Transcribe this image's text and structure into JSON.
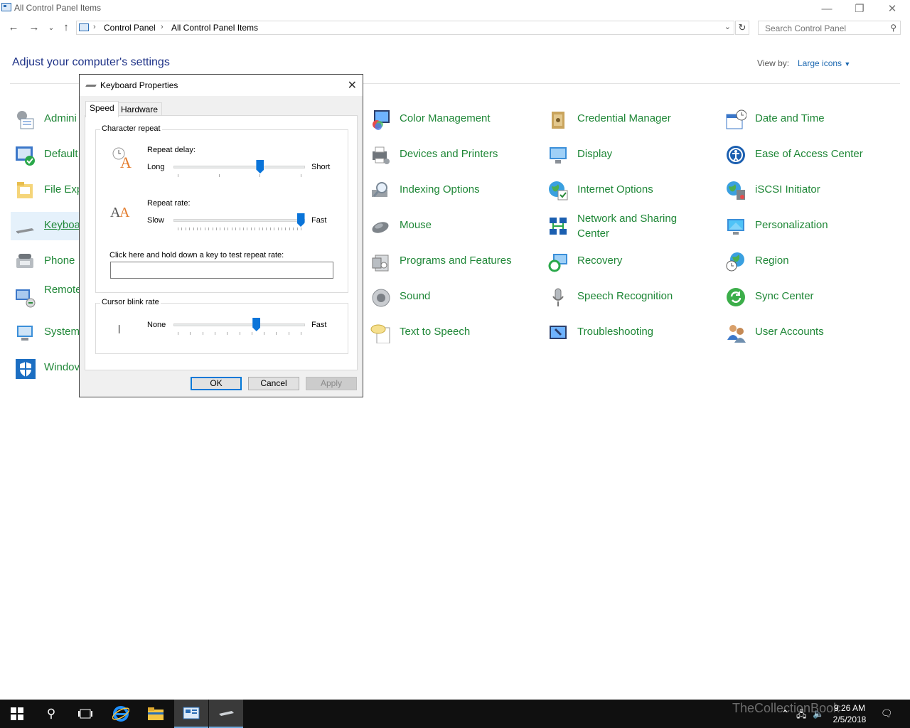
{
  "window": {
    "title": "All Control Panel Items",
    "controls": {
      "minimize": "—",
      "restore": "❐",
      "close": "✕"
    }
  },
  "address_bar": {
    "breadcrumbs": [
      "Control Panel",
      "All Control Panel Items"
    ],
    "search_placeholder": "Search Control Panel"
  },
  "header": {
    "title": "Adjust your computer's settings",
    "view_by_label": "View by:",
    "view_by_value": "Large icons"
  },
  "items": [
    {
      "label": "Admini",
      "icon": "admin-tools-icon"
    },
    {
      "label": "Default",
      "icon": "default-programs-icon"
    },
    {
      "label": "File Exp",
      "icon": "file-explorer-options-icon"
    },
    {
      "label": "Keyboa",
      "icon": "keyboard-icon",
      "selected": true
    },
    {
      "label": "Phone",
      "icon": "phone-modem-icon"
    },
    {
      "label": "Remote Connec",
      "icon": "remoteapp-icon"
    },
    {
      "label": "System",
      "icon": "system-icon"
    },
    {
      "label": "Windov",
      "icon": "windows-firewall-icon"
    },
    {
      "label": "Color Management",
      "icon": "color-management-icon"
    },
    {
      "label": "Devices and Printers",
      "icon": "printer-icon"
    },
    {
      "label": "Indexing Options",
      "icon": "indexing-icon"
    },
    {
      "label": "Mouse",
      "icon": "mouse-icon"
    },
    {
      "label": "Programs and Features",
      "icon": "programs-icon"
    },
    {
      "label": "Sound",
      "icon": "sound-icon"
    },
    {
      "label": "Text to Speech",
      "icon": "text-to-speech-icon"
    },
    {
      "label": "Credential Manager",
      "icon": "credential-manager-icon"
    },
    {
      "label": "Display",
      "icon": "display-icon"
    },
    {
      "label": "Internet Options",
      "icon": "internet-options-icon"
    },
    {
      "label": "Network and Sharing Center",
      "icon": "network-icon"
    },
    {
      "label": "Recovery",
      "icon": "recovery-icon"
    },
    {
      "label": "Speech Recognition",
      "icon": "microphone-icon"
    },
    {
      "label": "Troubleshooting",
      "icon": "troubleshooting-icon"
    },
    {
      "label": "Date and Time",
      "icon": "calendar-clock-icon"
    },
    {
      "label": "Ease of Access Center",
      "icon": "ease-of-access-icon"
    },
    {
      "label": "iSCSI Initiator",
      "icon": "iscsi-icon"
    },
    {
      "label": "Personalization",
      "icon": "personalization-icon"
    },
    {
      "label": "Region",
      "icon": "globe-clock-icon"
    },
    {
      "label": "Sync Center",
      "icon": "sync-icon"
    },
    {
      "label": "User Accounts",
      "icon": "users-icon"
    }
  ],
  "dialog": {
    "title": "Keyboard Properties",
    "tabs": [
      "Speed",
      "Hardware"
    ],
    "active_tab": "Speed",
    "character_repeat": {
      "group_label": "Character repeat",
      "repeat_delay": {
        "label": "Repeat delay:",
        "min_label": "Long",
        "max_label": "Short",
        "value_fraction": 0.67
      },
      "repeat_rate": {
        "label": "Repeat rate:",
        "min_label": "Slow",
        "max_label": "Fast",
        "value_fraction": 1.0
      },
      "test_label": "Click here and hold down a key to test repeat rate:",
      "test_value": ""
    },
    "cursor_blink": {
      "group_label": "Cursor blink rate",
      "min_label": "None",
      "max_label": "Fast",
      "value_fraction": 0.64
    },
    "buttons": {
      "ok": "OK",
      "cancel": "Cancel",
      "apply": "Apply"
    }
  },
  "taskbar": {
    "time": "9:26 AM",
    "date": "2/5/2018",
    "watermark": "TheCollectionBook"
  },
  "colors": {
    "link_green": "#1f8737",
    "heading_blue": "#1e3287",
    "slider_blue": "#0a74d9"
  }
}
